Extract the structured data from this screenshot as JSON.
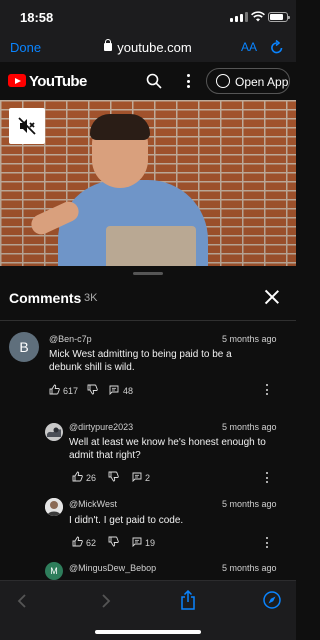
{
  "status_bar": {
    "time": "18:58"
  },
  "browser": {
    "done_label": "Done",
    "url": "youtube.com",
    "text_size_label": "AA"
  },
  "youtube_header": {
    "logo_text": "YouTube",
    "open_app_label": "Open App"
  },
  "comments_panel": {
    "title": "Comments",
    "count": "3K",
    "comments": [
      {
        "author": "@Ben-c7p",
        "avatar_letter": "B",
        "time": "5 months ago",
        "text": "Mick West admitting to being paid to be a debunk shill is wild.",
        "likes": "617",
        "replies": "48"
      },
      {
        "author": "@dirtypure2023",
        "time": "5 months ago",
        "text": "Well at least we know he's honest enough to admit that right?",
        "likes": "26",
        "replies": "2"
      },
      {
        "author": "@MickWest",
        "time": "5 months ago",
        "text": "I didn't. I get paid to code.",
        "likes": "62",
        "replies": "19"
      },
      {
        "author": "@MingusDew_Bebop",
        "avatar_letter": "M",
        "time": "5 months ago",
        "text": ""
      }
    ]
  },
  "colors": {
    "background": "#0f0f0f",
    "safari_blue": "#0a84ff",
    "youtube_red": "#ff0000"
  }
}
